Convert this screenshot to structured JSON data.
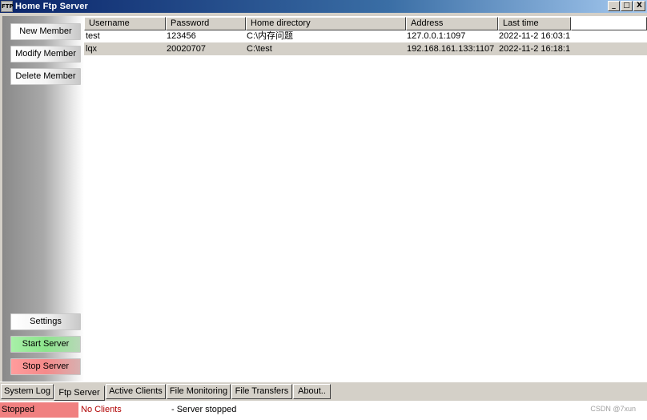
{
  "window": {
    "icon_text": "FTP",
    "title": "Home Ftp Server",
    "controls": {
      "minimize": "_",
      "maximize": "□",
      "close": "X"
    }
  },
  "sidebar": {
    "new_member": "New Member",
    "modify_member": "Modify Member",
    "delete_member": "Delete Member",
    "settings": "Settings",
    "start_server": "Start Server",
    "stop_server": "Stop Server"
  },
  "table": {
    "columns": [
      "Username",
      "Password",
      "Home directory",
      "Address",
      "Last time"
    ],
    "rows": [
      {
        "username": "test",
        "password": "123456",
        "home": "C:\\内存问题",
        "address": "127.0.0.1:1097",
        "last": "2022-11-2 16:03:1"
      },
      {
        "username": "lqx",
        "password": "20020707",
        "home": "C:\\test",
        "address": "192.168.161.133:1107",
        "last": "2022-11-2 16:18:1"
      }
    ]
  },
  "tabs": [
    "System Log",
    "Ftp Server",
    "Active Clients",
    "File Monitoring",
    "File Transfers",
    "About.."
  ],
  "status": {
    "state": "Stopped",
    "clients": "No Clients",
    "message": "- Server stopped",
    "watermark": "CSDN @7xun"
  }
}
